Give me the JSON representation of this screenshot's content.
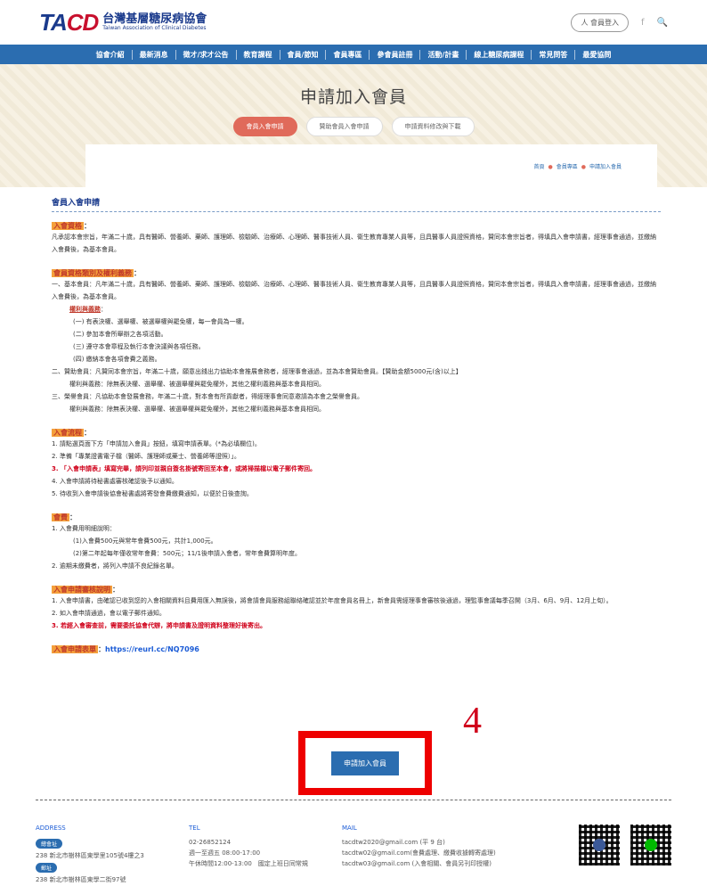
{
  "header": {
    "logo_mark": "TA",
    "logo_mark_red": "CD",
    "logo_zh": "台灣基層糖尿病協會",
    "logo_en": "Taiwan Association of Clinical Diabetes",
    "member_label": "人 會員登入",
    "fb_icon": "f",
    "search_icon": "🔍"
  },
  "nav": {
    "items": [
      "協會介紹",
      "最新消息",
      "徵才/求才公告",
      "教育課程",
      "會員/節知",
      "會員專區",
      "參會員註冊",
      "活動/計畫",
      "線上糖尿病課程",
      "常見問答",
      "最愛協問"
    ]
  },
  "hero": {
    "title": "申請加入會員",
    "tabs": [
      "會員入會申請",
      "贊助會員入會申請",
      "申請資料修改與下載"
    ],
    "breadcrumb": [
      "首頁",
      "會員專區",
      "申請加入會員"
    ]
  },
  "content": {
    "section_title": "會員入會申請",
    "blocks": [
      {
        "head": "入會資格",
        "lines": [
          "凡承認本會宗旨，年滿二十歲，具有醫師、營養師、藥師、護理師、檢驗師、治療師、心理師、醫事技術人員、衛生教育專業人員等，且具醫事人員證照資格，贊同本會宗旨者，得填具入會申請書，經理事會通過，並繳納入會費後，為基本會員。"
        ]
      },
      {
        "head": "會員資格類別及權利義務",
        "lines": [
          "一、基本會員：凡年滿二十歲，具有醫師、營養師、藥師、護理師、檢驗師、治療師、心理師、醫事技術人員、衛生教育專業人員等，且具醫事人員證照資格，贊同本會宗旨者，得填具入會申請書，經理事會通過，並繳納入會費後，為基本會員。",
          "權利與義務",
          "(一) 有表決權、選舉權、被選舉權與罷免權，每一會員為一權。",
          "(二) 參加本會所舉辦之各項活動。",
          "(三) 遵守本會章程及執行本會決議與各項任務。",
          "(四) 繳納本會各項會費之義務。",
          "二、贊助會員：凡贊同本會宗旨，年滿二十歲，願意出錢出力協助本會推展會務者，經理事會通過，並為本會贊助會員。【贊助金額5000元(含)以上】",
          "權利與義務：除無表決權、選舉權、被選舉權與罷免權外，其他之權利義務與基本會員相同。",
          "三、榮譽會員：凡協助本會發展會務，年滿二十歲，對本會有所貢獻者，得經理事會同意邀請為本會之榮譽會員。",
          "權利與義務：除無表決權、選舉權、被選舉權與罷免權外，其他之權利義務與基本會員相同。"
        ]
      },
      {
        "head": "入會流程",
        "lines": [
          "1. 請點選頁面下方「申請加入會員」按鈕，填寫申請表單。(*為必填欄位)。",
          "2. 準備「專業證書電子檔（醫師、護理師或藥士、營養師等證照）」。",
          "3. 「入會申請表」填寫完畢，請列印並親自簽名掛號寄回至本會，或將掃描檔以電子郵件寄回。",
          "4. 入會申請將待秘書處審核確認後予以通知。",
          "5. 待收到入會申請後協會秘書處將寄發會費繳費通知，以便於日後查詢。"
        ]
      },
      {
        "head": "會費",
        "lines": [
          "1. 入會費用明細說明：",
          "(1)入會費500元與常年會費500元，共計1,000元。",
          "(2)第二年起每年僅收常年會費：500元；11/1後申請入會者，常年會費算明年度。",
          "2. 逾期未繳費者，將列入申請不良紀錄名單。"
        ]
      },
      {
        "head": "入會申請審核說明",
        "lines": [
          "1. 入會申請書，由確認已收到您的入會相關資料且費用匯入無誤後，將會請會員服務組聯絡確認並於年度會員名冊上，新會員需經理事會審核後通過，理監事會議每季召開（3月、6月、9月、12月上旬）。",
          "2. 如入會申請通過，會以電子郵件通知。",
          "3. 若經入會審查前，需要委託協會代辦，將申請書及證明資料整理好後寄出。"
        ]
      }
    ],
    "form_label": "入會申請表單",
    "form_link": "https://reurl.cc/NQ7096"
  },
  "apply_button": "申請加入會員",
  "step_number": "4",
  "footer": {
    "address_title": "ADDRESS",
    "address_badge1": "總會址",
    "address1": "238 新北市樹林區東學里105號4樓之3",
    "address_badge2": "郵址",
    "address2": "238 新北市樹林區東學二街97號",
    "tel_title": "TEL",
    "tel_lines": [
      "02-26852124",
      "週一至週五 08:00-17:00",
      "午休時間12:00-13:00　國定上班日同常規"
    ],
    "mail_title": "MAIL",
    "mail_lines": [
      "tacdtw2020@gmail.com (平 9 台)",
      "tacdtw02@gmail.com(會費處理、繳費收據轉寄處理)",
      "tacdtw03@gmail.com (入會相關、會員另刊印授權)"
    ]
  },
  "colors": {
    "nav": "#2b6db0",
    "accent": "#e06a5a",
    "hero_bg": "#f7f1e3",
    "alert": "#d0021b"
  }
}
